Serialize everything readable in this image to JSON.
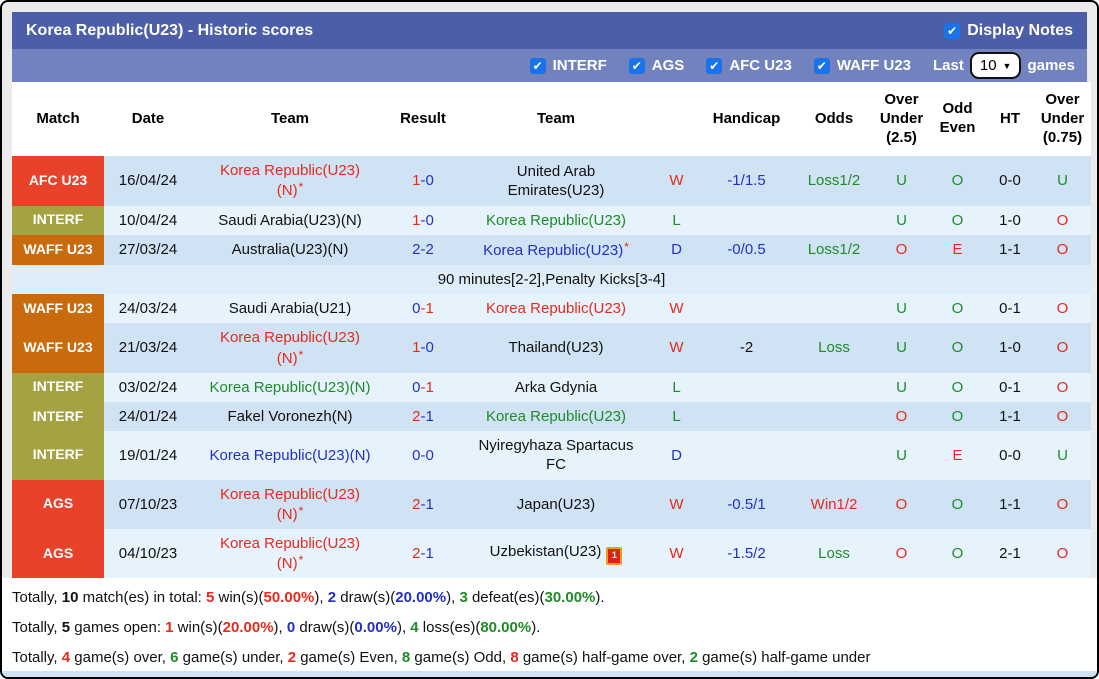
{
  "header": {
    "title": "Korea Republic(U23) - Historic scores",
    "display_notes": {
      "label": "Display Notes",
      "checked": true
    },
    "filters": [
      {
        "label": "INTERF",
        "checked": true
      },
      {
        "label": "AGS",
        "checked": true
      },
      {
        "label": "AFC U23",
        "checked": true
      },
      {
        "label": "WAFF U23",
        "checked": true
      }
    ],
    "last_label": "Last",
    "last_value": "10",
    "games_label": "games"
  },
  "table": {
    "columns": [
      "Match",
      "Date",
      "Team",
      "Result",
      "Team",
      "",
      "Handicap",
      "Odds",
      "Over\nUnder\n(2.5)",
      "Odd\nEven",
      "HT",
      "Over\nUnder\n(0.75)"
    ],
    "rows": [
      {
        "badge": "AFC U23",
        "badge_color": "#e8432a",
        "date": "16/04/24",
        "home": "Korea Republic(U23)\n(N)",
        "home_star": true,
        "home_color": "red",
        "score_home": "1",
        "score_away": "0",
        "score_home_color": "red",
        "score_away_color": "blue",
        "away": "United Arab\nEmirates(U23)",
        "away_star": false,
        "away_color": "black",
        "away_icon": null,
        "wdl": "W",
        "wdl_color": "red",
        "handicap": "-1/1.5",
        "handicap_color": "blue",
        "odds": "Loss1/2",
        "odds_color": "green",
        "ou25": "U",
        "ou25_color": "green",
        "oe": "O",
        "oe_color": "green",
        "ht": "0-0",
        "ou075": "U",
        "ou075_color": "green",
        "shade": "dark"
      },
      {
        "badge": "INTERF",
        "badge_color": "#a4a242",
        "date": "10/04/24",
        "home": "Saudi Arabia(U23)(N)",
        "home_star": false,
        "home_color": "black",
        "score_home": "1",
        "score_away": "0",
        "score_home_color": "red",
        "score_away_color": "blue",
        "away": "Korea Republic(U23)",
        "away_star": false,
        "away_color": "green",
        "away_icon": null,
        "wdl": "L",
        "wdl_color": "green",
        "handicap": "",
        "handicap_color": "blue",
        "odds": "",
        "odds_color": "green",
        "ou25": "U",
        "ou25_color": "green",
        "oe": "O",
        "oe_color": "green",
        "ht": "1-0",
        "ou075": "O",
        "ou075_color": "red",
        "shade": "light"
      },
      {
        "badge": "WAFF U23",
        "badge_color": "#c96a0e",
        "date": "27/03/24",
        "home": "Australia(U23)(N)",
        "home_star": false,
        "home_color": "black",
        "score_home": "2",
        "score_away": "2",
        "score_home_color": "blue",
        "score_away_color": "blue",
        "away": "Korea Republic(U23)",
        "away_star": true,
        "away_color": "blue",
        "away_icon": null,
        "wdl": "D",
        "wdl_color": "blue",
        "handicap": "-0/0.5",
        "handicap_color": "blue",
        "odds": "Loss1/2",
        "odds_color": "green",
        "ou25": "O",
        "ou25_color": "red",
        "oe": "E",
        "oe_color": "red",
        "ht": "1-1",
        "ou075": "O",
        "ou075_color": "red",
        "shade": "dark"
      },
      {
        "note": true,
        "text": "90 minutes[2-2],Penalty Kicks[3-4]"
      },
      {
        "badge": "WAFF U23",
        "badge_color": "#c96a0e",
        "date": "24/03/24",
        "home": "Saudi Arabia(U21)",
        "home_star": false,
        "home_color": "black",
        "score_home": "0",
        "score_away": "1",
        "score_home_color": "blue",
        "score_away_color": "red",
        "away": "Korea Republic(U23)",
        "away_star": false,
        "away_color": "red",
        "away_icon": null,
        "wdl": "W",
        "wdl_color": "red",
        "handicap": "",
        "handicap_color": "blue",
        "odds": "",
        "odds_color": "green",
        "ou25": "U",
        "ou25_color": "green",
        "oe": "O",
        "oe_color": "green",
        "ht": "0-1",
        "ou075": "O",
        "ou075_color": "red",
        "shade": "light"
      },
      {
        "badge": "WAFF U23",
        "badge_color": "#c96a0e",
        "date": "21/03/24",
        "home": "Korea Republic(U23)\n(N)",
        "home_star": true,
        "home_color": "red",
        "score_home": "1",
        "score_away": "0",
        "score_home_color": "red",
        "score_away_color": "blue",
        "away": "Thailand(U23)",
        "away_star": false,
        "away_color": "black",
        "away_icon": null,
        "wdl": "W",
        "wdl_color": "red",
        "handicap": "-2",
        "handicap_color": "black",
        "odds": "Loss",
        "odds_color": "green",
        "ou25": "U",
        "ou25_color": "green",
        "oe": "O",
        "oe_color": "green",
        "ht": "1-0",
        "ou075": "O",
        "ou075_color": "red",
        "shade": "dark"
      },
      {
        "badge": "INTERF",
        "badge_color": "#a4a242",
        "date": "03/02/24",
        "home": "Korea Republic(U23)(N)",
        "home_star": false,
        "home_color": "green",
        "score_home": "0",
        "score_away": "1",
        "score_home_color": "blue",
        "score_away_color": "red",
        "away": "Arka Gdynia",
        "away_star": false,
        "away_color": "black",
        "away_icon": null,
        "wdl": "L",
        "wdl_color": "green",
        "handicap": "",
        "handicap_color": "blue",
        "odds": "",
        "odds_color": "green",
        "ou25": "U",
        "ou25_color": "green",
        "oe": "O",
        "oe_color": "green",
        "ht": "0-1",
        "ou075": "O",
        "ou075_color": "red",
        "shade": "light"
      },
      {
        "badge": "INTERF",
        "badge_color": "#a4a242",
        "date": "24/01/24",
        "home": "Fakel Voronezh(N)",
        "home_star": false,
        "home_color": "black",
        "score_home": "2",
        "score_away": "1",
        "score_home_color": "red",
        "score_away_color": "blue",
        "away": "Korea Republic(U23)",
        "away_star": false,
        "away_color": "green",
        "away_icon": null,
        "wdl": "L",
        "wdl_color": "green",
        "handicap": "",
        "handicap_color": "blue",
        "odds": "",
        "odds_color": "green",
        "ou25": "O",
        "ou25_color": "red",
        "oe": "O",
        "oe_color": "green",
        "ht": "1-1",
        "ou075": "O",
        "ou075_color": "red",
        "shade": "dark"
      },
      {
        "badge": "INTERF",
        "badge_color": "#a4a242",
        "date": "19/01/24",
        "home": "Korea Republic(U23)(N)",
        "home_star": false,
        "home_color": "blue",
        "score_home": "0",
        "score_away": "0",
        "score_home_color": "blue",
        "score_away_color": "blue",
        "away": "Nyiregyhaza Spartacus\nFC",
        "away_star": false,
        "away_color": "black",
        "away_icon": null,
        "wdl": "D",
        "wdl_color": "blue",
        "handicap": "",
        "handicap_color": "blue",
        "odds": "",
        "odds_color": "green",
        "ou25": "U",
        "ou25_color": "green",
        "oe": "E",
        "oe_color": "red",
        "ht": "0-0",
        "ou075": "U",
        "ou075_color": "green",
        "shade": "light"
      },
      {
        "badge": "AGS",
        "badge_color": "#e8432a",
        "date": "07/10/23",
        "home": "Korea Republic(U23)\n(N)",
        "home_star": true,
        "home_color": "red",
        "score_home": "2",
        "score_away": "1",
        "score_home_color": "red",
        "score_away_color": "blue",
        "away": "Japan(U23)",
        "away_star": false,
        "away_color": "black",
        "away_icon": null,
        "wdl": "W",
        "wdl_color": "red",
        "handicap": "-0.5/1",
        "handicap_color": "blue",
        "odds": "Win1/2",
        "odds_color": "red",
        "ou25": "O",
        "ou25_color": "red",
        "oe": "O",
        "oe_color": "green",
        "ht": "1-1",
        "ou075": "O",
        "ou075_color": "red",
        "shade": "dark"
      },
      {
        "badge": "AGS",
        "badge_color": "#e8432a",
        "date": "04/10/23",
        "home": "Korea Republic(U23)\n(N)",
        "home_star": true,
        "home_color": "red",
        "score_home": "2",
        "score_away": "1",
        "score_home_color": "red",
        "score_away_color": "blue",
        "away": "Uzbekistan(U23)",
        "away_star": false,
        "away_color": "black",
        "away_icon": "red-card-1",
        "wdl": "W",
        "wdl_color": "red",
        "handicap": "-1.5/2",
        "handicap_color": "blue",
        "odds": "Loss",
        "odds_color": "green",
        "ou25": "O",
        "ou25_color": "red",
        "oe": "O",
        "oe_color": "green",
        "ht": "2-1",
        "ou075": "O",
        "ou075_color": "red",
        "shade": "light"
      }
    ]
  },
  "summary": {
    "lines": [
      {
        "segments": [
          {
            "t": "Totally, "
          },
          {
            "t": "10",
            "c": "black",
            "b": true
          },
          {
            "t": " match(es) in total: "
          },
          {
            "t": "5",
            "c": "red",
            "b": true
          },
          {
            "t": " win(s)("
          },
          {
            "t": "50.00%",
            "c": "red",
            "b": true
          },
          {
            "t": "), "
          },
          {
            "t": "2",
            "c": "blue",
            "b": true
          },
          {
            "t": " draw(s)("
          },
          {
            "t": "20.00%",
            "c": "blue",
            "b": true
          },
          {
            "t": "), "
          },
          {
            "t": "3",
            "c": "green",
            "b": true
          },
          {
            "t": " defeat(es)("
          },
          {
            "t": "30.00%",
            "c": "green",
            "b": true
          },
          {
            "t": ")."
          }
        ]
      },
      {
        "segments": [
          {
            "t": "Totally, "
          },
          {
            "t": "5",
            "c": "black",
            "b": true
          },
          {
            "t": " games open: "
          },
          {
            "t": "1",
            "c": "red",
            "b": true
          },
          {
            "t": " win(s)("
          },
          {
            "t": "20.00%",
            "c": "red",
            "b": true
          },
          {
            "t": "), "
          },
          {
            "t": "0",
            "c": "blue",
            "b": true
          },
          {
            "t": " draw(s)("
          },
          {
            "t": "0.00%",
            "c": "blue",
            "b": true
          },
          {
            "t": "), "
          },
          {
            "t": "4",
            "c": "green",
            "b": true
          },
          {
            "t": " loss(es)("
          },
          {
            "t": "80.00%",
            "c": "green",
            "b": true
          },
          {
            "t": ")."
          }
        ]
      },
      {
        "segments": [
          {
            "t": "Totally, "
          },
          {
            "t": "4",
            "c": "red",
            "b": true
          },
          {
            "t": " game(s) over, "
          },
          {
            "t": "6",
            "c": "green",
            "b": true
          },
          {
            "t": " game(s) under, "
          },
          {
            "t": "2",
            "c": "red",
            "b": true
          },
          {
            "t": " game(s) Even, "
          },
          {
            "t": "8",
            "c": "green",
            "b": true
          },
          {
            "t": " game(s) Odd, "
          },
          {
            "t": "8",
            "c": "red",
            "b": true
          },
          {
            "t": " game(s) half-game over, "
          },
          {
            "t": "2",
            "c": "green",
            "b": true
          },
          {
            "t": " game(s) half-game under"
          }
        ]
      }
    ]
  },
  "icons": {
    "checkbox_check": "checkmark-icon",
    "select_chevron": "chevron-down-icon",
    "red_card_label": "1"
  },
  "colors": {
    "header_bar": "#4c5ea7",
    "filter_bar": "#7282bf",
    "row_dark": "#cfe3f4",
    "row_light": "#e7f3fc",
    "note_row": "#ddeefa",
    "checkbox_blue": "#1a73e8",
    "badge_afc_u23": "#e8432a",
    "badge_interf": "#a4a242",
    "badge_waff_u23": "#c96a0e",
    "badge_ags": "#e8432a",
    "win_red": "#e8291c",
    "draw_blue": "#2330c8",
    "loss_green": "#1f8b27"
  }
}
